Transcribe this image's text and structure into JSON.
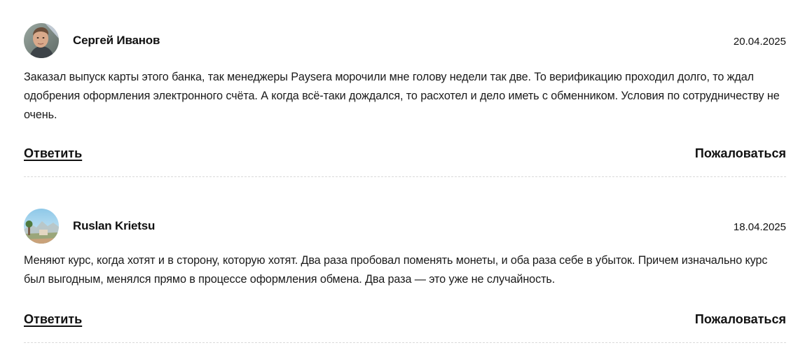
{
  "comments": [
    {
      "author": "Сергей Иванов",
      "date": "20.04.2025",
      "avatar_icon": "user-photo-avatar",
      "text": "Заказал выпуск карты этого банка, так менеджеры Paysera морочили мне голову недели так две. То верификацию проходил долго, то ждал одобрения оформления электронного счёта. А когда всё-таки дождался, то расхотел и дело иметь с обменником. Условия по сотрудничеству не очень.",
      "reply_label": "Ответить",
      "report_label": "Пожаловаться"
    },
    {
      "author": "Ruslan Krietsu",
      "date": "18.04.2025",
      "avatar_icon": "landscape-photo-avatar",
      "text": "Меняют курс, когда хотят и в сторону, которую хотят. Два раза пробовал поменять монеты, и оба раза себе в убыток. Причем изначально курс был выгодным, менялся прямо в процессе оформления обмена. Два раза — это уже не случайность.",
      "reply_label": "Ответить",
      "report_label": "Пожаловаться"
    }
  ]
}
